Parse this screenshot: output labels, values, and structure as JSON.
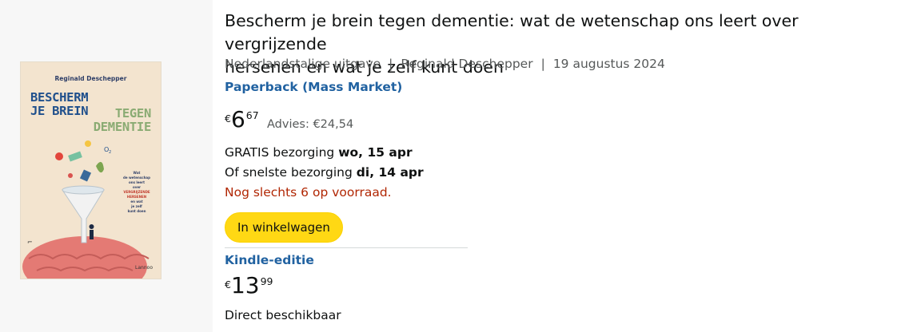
{
  "book": {
    "cover": {
      "author": "Reginald Deschepper",
      "title_line1": "BESCHERM",
      "title_line2": "JE BREIN",
      "title_line3": "TEGEN",
      "title_line4": "DEMENTIE",
      "subtitle_lines": [
        "Wat",
        "de wetenschap",
        "ons leert",
        "over",
        "VERGRIJZENDE",
        "HERSENEN",
        "en wat",
        "je zelf",
        "kunt doen"
      ],
      "publisher": "Lannoo"
    },
    "title_line1": "Bescherm je brein tegen dementie: wat de wetenschap ons leert over vergrijzende",
    "title_line2": "hersenen en wat je zelf kunt doen",
    "language": "Nederlandstalige uitgave",
    "separator": "|",
    "author": "Reginald Deschepper",
    "date": "19 augustus 2024"
  },
  "paperback": {
    "format_label": "Paperback (Mass Market)",
    "currency": "€",
    "price_whole": "6",
    "price_fraction": "67",
    "list_price": "Advies: €24,54",
    "free_delivery_prefix": "GRATIS bezorging ",
    "free_delivery_date": "wo, 15 apr",
    "fast_delivery_prefix": "Of snelste bezorging ",
    "fast_delivery_date": "di, 14 apr",
    "stock_message": "Nog slechts 6 op voorraad.",
    "cart_button_label": "In winkelwagen"
  },
  "kindle": {
    "format_label": "Kindle-editie",
    "currency": "€",
    "price_whole": "13",
    "price_fraction": "99",
    "availability": "Direct beschikbaar"
  },
  "colors": {
    "link": "#2162a1",
    "stock_warning": "#b12704",
    "cart_button": "#ffd814",
    "secondary_text": "#565959"
  }
}
